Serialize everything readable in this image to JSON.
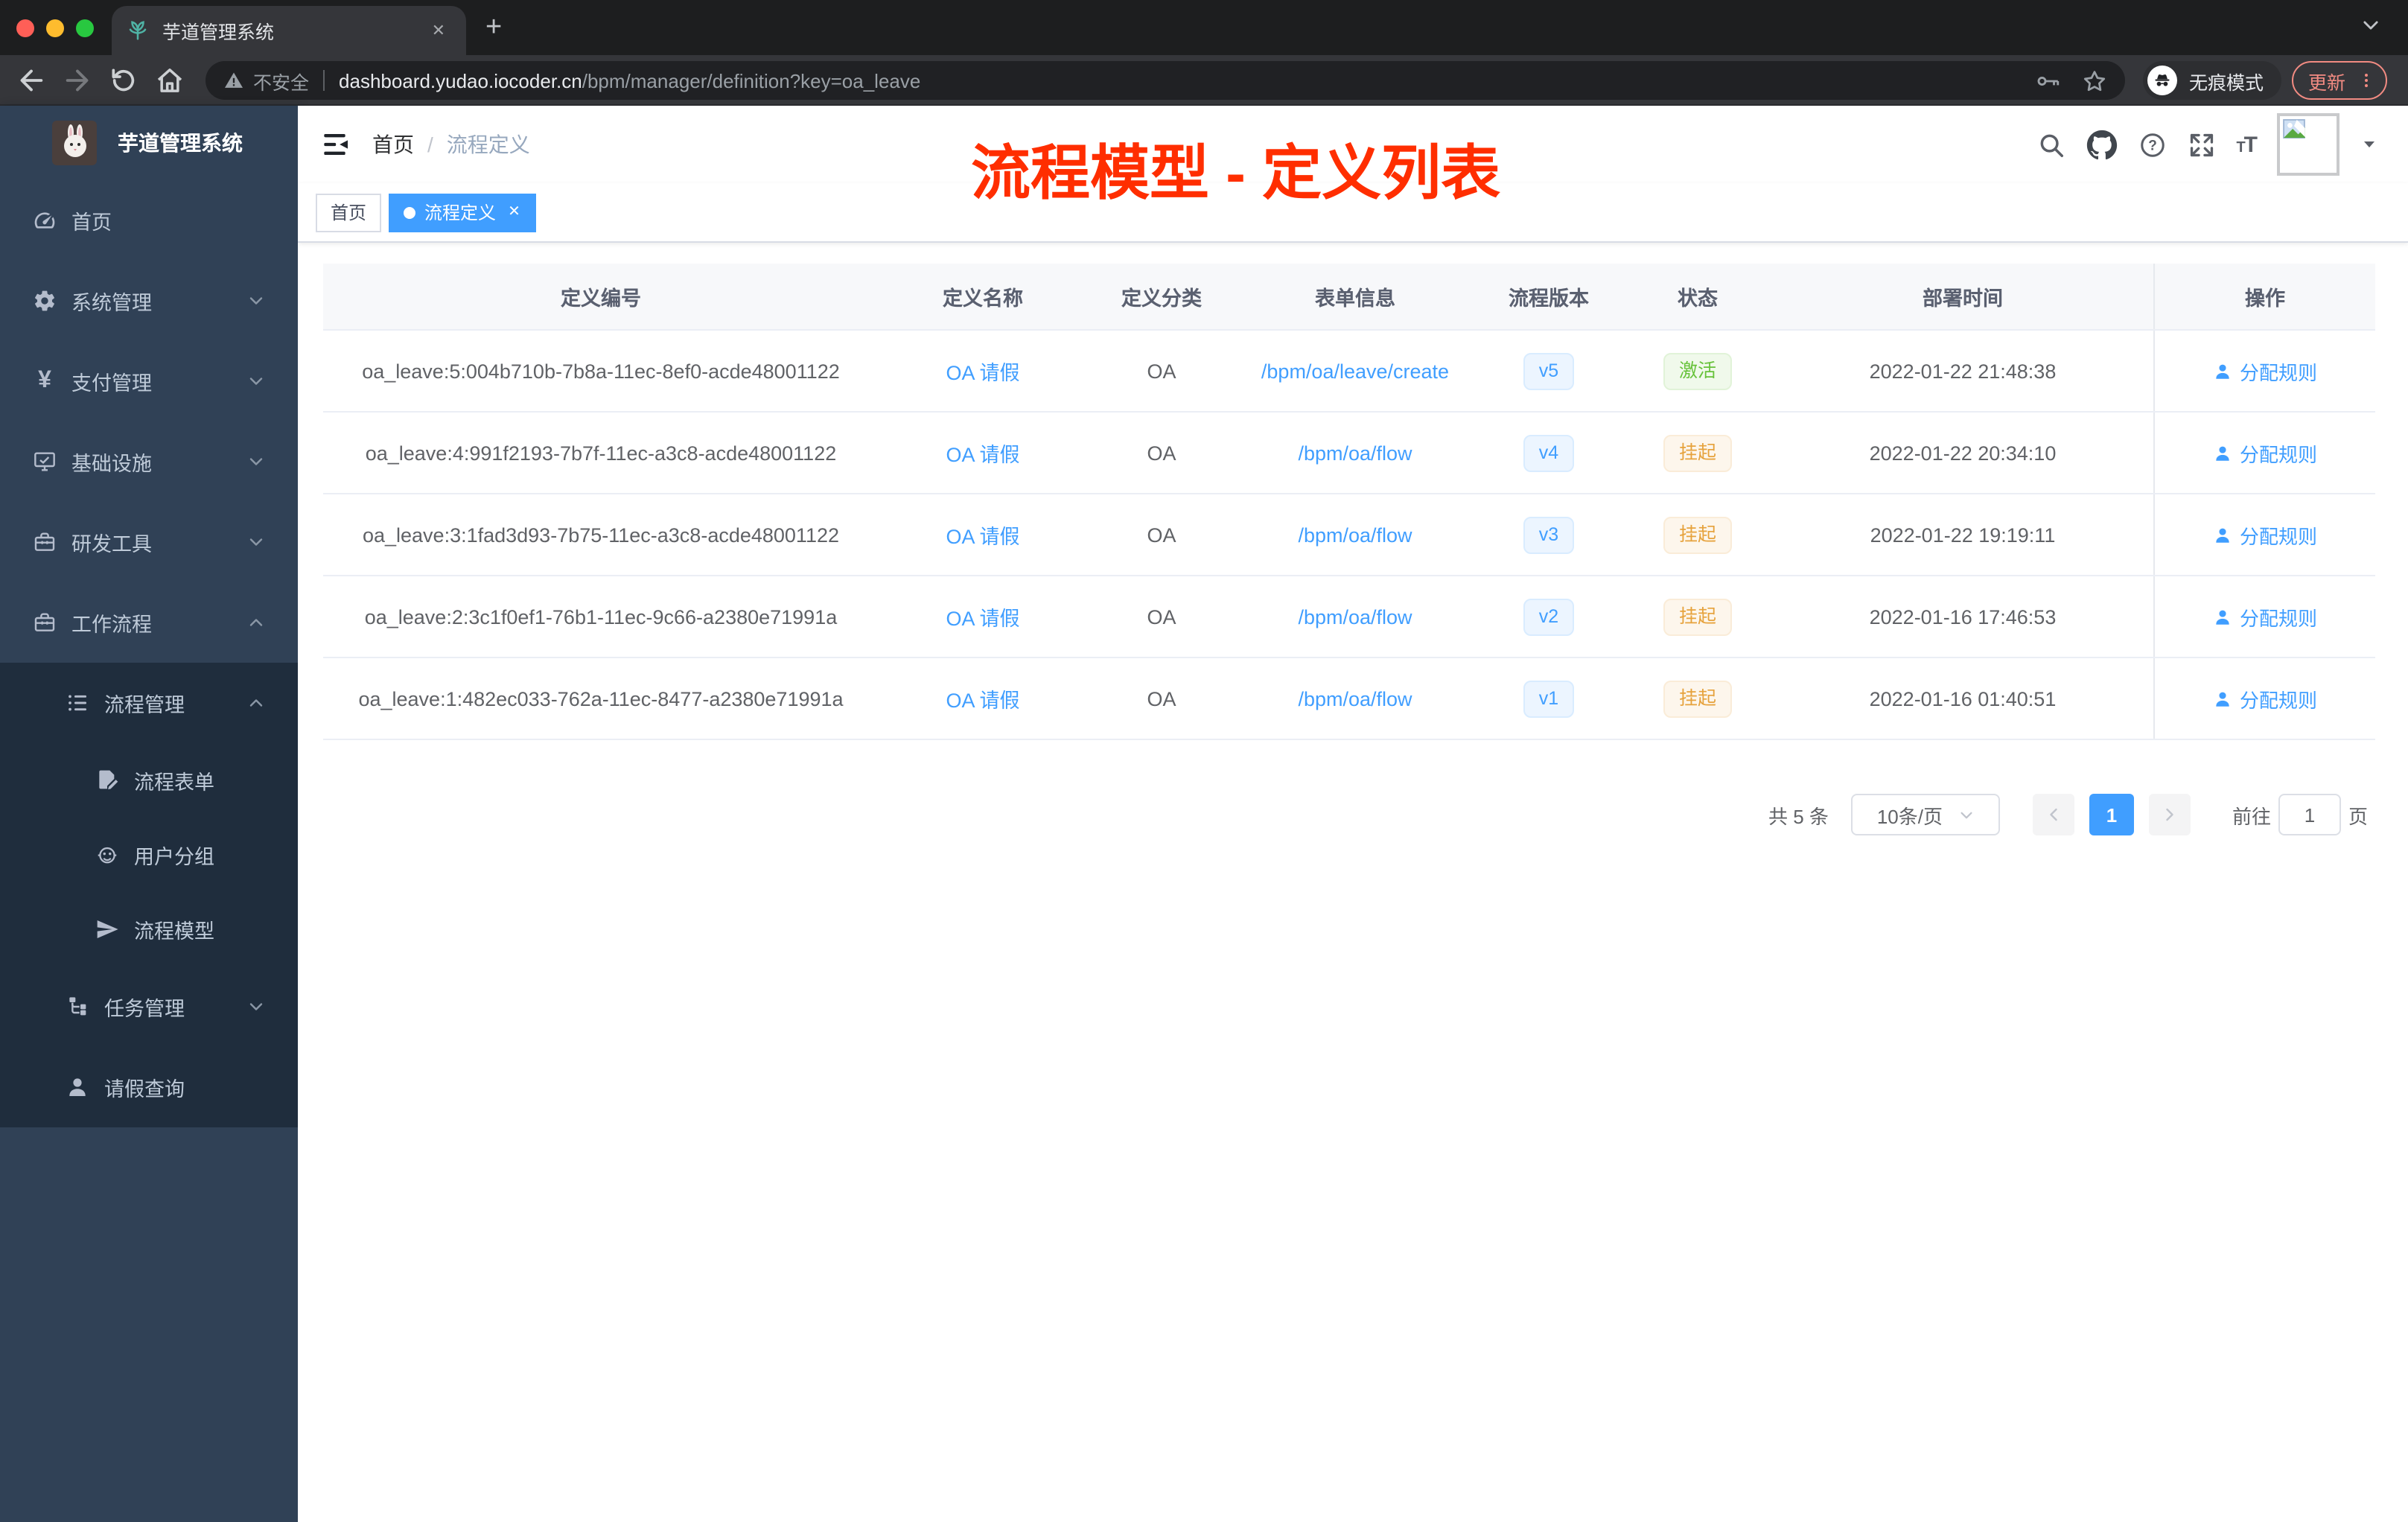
{
  "browser": {
    "tab_title": "芋道管理系统",
    "security_label": "不安全",
    "url_domain": "dashboard.yudao.iocoder.cn",
    "url_path": "/bpm/manager/definition?key=oa_leave",
    "incognito_label": "无痕模式",
    "update_label": "更新"
  },
  "sidebar": {
    "app_title": "芋道管理系统",
    "menu": [
      {
        "label": "首页",
        "icon": "dashboard",
        "level": 0
      },
      {
        "label": "系统管理",
        "icon": "gear",
        "level": 0,
        "chevron": "down"
      },
      {
        "label": "支付管理",
        "icon": "yen",
        "level": 0,
        "chevron": "down"
      },
      {
        "label": "基础设施",
        "icon": "monitor",
        "level": 0,
        "chevron": "down"
      },
      {
        "label": "研发工具",
        "icon": "toolbox",
        "level": 0,
        "chevron": "down"
      },
      {
        "label": "工作流程",
        "icon": "toolbox",
        "level": 0,
        "chevron": "up"
      },
      {
        "label": "流程管理",
        "icon": "listtree",
        "level": 1,
        "chevron": "up"
      },
      {
        "label": "流程表单",
        "icon": "formdoc",
        "level": 2
      },
      {
        "label": "用户分组",
        "icon": "robot",
        "level": 2
      },
      {
        "label": "流程模型",
        "icon": "plane",
        "level": 2
      },
      {
        "label": "任务管理",
        "icon": "tasktree",
        "level": 1,
        "chevron": "down"
      },
      {
        "label": "请假查询",
        "icon": "user",
        "level": 1
      }
    ]
  },
  "header": {
    "breadcrumb_home": "首页",
    "breadcrumb_separator": "/",
    "breadcrumb_current": "流程定义",
    "annotation": "流程模型 - 定义列表",
    "annotation_color": "#ff2e00"
  },
  "tags": {
    "home": "首页",
    "active": "流程定义"
  },
  "table": {
    "columns": [
      "定义编号",
      "定义名称",
      "定义分类",
      "表单信息",
      "流程版本",
      "状态",
      "部署时间",
      "操作"
    ],
    "action_label": "分配规则",
    "rows": [
      {
        "id": "oa_leave:5:004b710b-7b8a-11ec-8ef0-acde48001122",
        "name": "OA 请假",
        "category": "OA",
        "form": "/bpm/oa/leave/create",
        "version": "v5",
        "status": "激活",
        "status_type": "success",
        "deployed": "2022-01-22 21:48:38"
      },
      {
        "id": "oa_leave:4:991f2193-7b7f-11ec-a3c8-acde48001122",
        "name": "OA 请假",
        "category": "OA",
        "form": "/bpm/oa/flow",
        "version": "v4",
        "status": "挂起",
        "status_type": "warning",
        "deployed": "2022-01-22 20:34:10"
      },
      {
        "id": "oa_leave:3:1fad3d93-7b75-11ec-a3c8-acde48001122",
        "name": "OA 请假",
        "category": "OA",
        "form": "/bpm/oa/flow",
        "version": "v3",
        "status": "挂起",
        "status_type": "warning",
        "deployed": "2022-01-22 19:19:11"
      },
      {
        "id": "oa_leave:2:3c1f0ef1-76b1-11ec-9c66-a2380e71991a",
        "name": "OA 请假",
        "category": "OA",
        "form": "/bpm/oa/flow",
        "version": "v2",
        "status": "挂起",
        "status_type": "warning",
        "deployed": "2022-01-16 17:46:53"
      },
      {
        "id": "oa_leave:1:482ec033-762a-11ec-8477-a2380e71991a",
        "name": "OA 请假",
        "category": "OA",
        "form": "/bpm/oa/flow",
        "version": "v1",
        "status": "挂起",
        "status_type": "warning",
        "deployed": "2022-01-16 01:40:51"
      }
    ]
  },
  "pagination": {
    "total": "共 5 条",
    "page_size": "10条/页",
    "current_page": "1",
    "goto_label": "前往",
    "goto_value": "1",
    "unit_label": "页"
  },
  "colors": {
    "accent_blue": "#409eff",
    "annotation_red": "#ff2e00",
    "status_active_green": "#67c23a",
    "status_suspend_orange": "#e6a23c",
    "sidebar_bg": "#304156",
    "submenu_bg": "#1f2d3d"
  }
}
